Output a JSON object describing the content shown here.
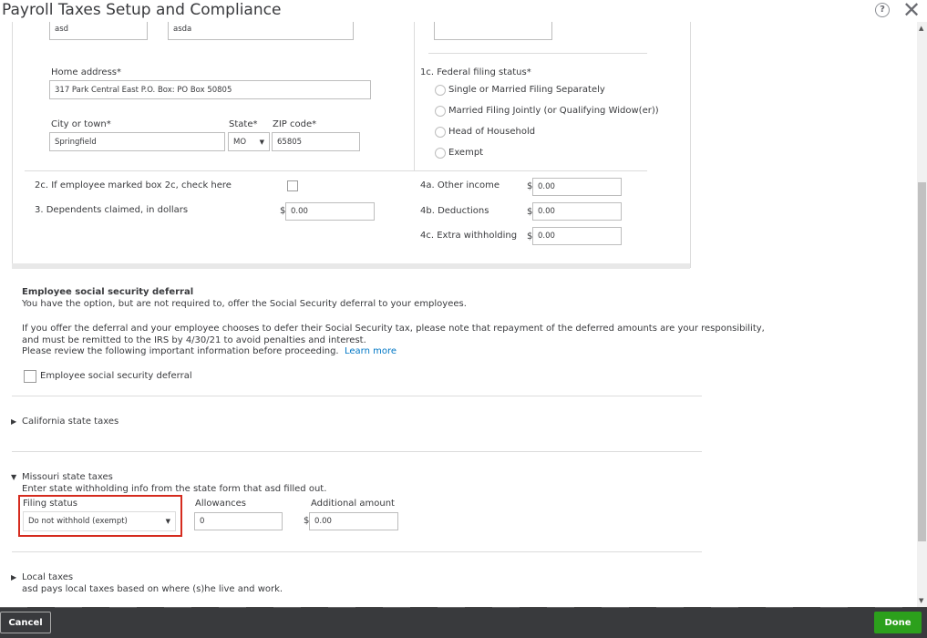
{
  "window": {
    "title": "Payroll Taxes Setup and Compliance",
    "help_glyph": "?",
    "close_glyph": "✕"
  },
  "form": {
    "first_name_value": "asd",
    "last_name_value": "asda",
    "home_address_label": "Home address*",
    "home_address_value": "317 Park Central East P.O. Box: PO Box 50805",
    "city_label": "City or town*",
    "city_value": "Springfield",
    "state_label": "State*",
    "state_value": "MO",
    "zip_label": "ZIP code*",
    "zip_value": "65805",
    "filing_status_label": "1c. Federal filing status*",
    "filing_options": [
      "Single or Married Filing Separately",
      "Married Filing Jointly (or Qualifying Widow(er))",
      "Head of Household",
      "Exempt"
    ],
    "box2c_label": "2c. If employee marked box 2c, check here",
    "dependents_label": "3.   Dependents claimed, in dollars",
    "dependents_value": "0.00",
    "other_income_label": "4a. Other income",
    "other_income_value": "0.00",
    "deductions_label": "4b. Deductions",
    "deductions_value": "0.00",
    "extra_withholding_label": "4c. Extra withholding",
    "extra_withholding_value": "0.00",
    "currency": "$"
  },
  "deferral": {
    "heading": "Employee social security deferral",
    "line1": "You have the option, but are not required to, offer the Social Security deferral to your employees.",
    "line2": "If you offer the deferral and your employee chooses to defer their Social Security tax, please note that repayment of the deferred amounts are your responsibility,",
    "line3": "and must be remitted to the IRS by 4/30/21 to avoid penalties and interest.",
    "line4": "Please review the following important information before proceeding.",
    "learn_more": "Learn more",
    "checkbox_label": "Employee social security deferral"
  },
  "california": {
    "heading": "California state taxes"
  },
  "missouri": {
    "heading": "Missouri state taxes",
    "description": "Enter state withholding info from the state form that asd filled out.",
    "filing_status_label": "Filing status",
    "filing_status_value": "Do not withhold (exempt)",
    "allowances_label": "Allowances",
    "allowances_value": "0",
    "additional_amount_label": "Additional amount",
    "additional_amount_value": "0.00"
  },
  "local": {
    "heading": "Local taxes",
    "description": "asd pays local taxes based on where (s)he live and work."
  },
  "footer": {
    "cancel_label": "Cancel",
    "done_label": "Done"
  }
}
